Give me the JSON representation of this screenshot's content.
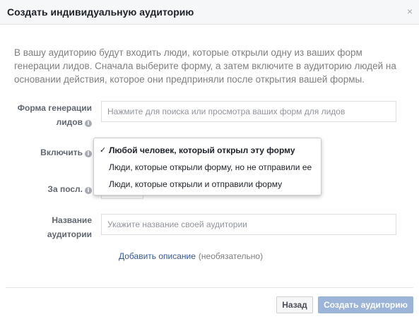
{
  "dialog": {
    "title": "Создать индивидуальную аудиторию",
    "close_icon": "×"
  },
  "intro": "В вашу аудиторию будут входить люди, которые открыли одну из ваших форм генерации лидов. Сначала выберите форму, а затем включите в аудиторию людей на основании действия, которое они предприняли после открытия вашей формы.",
  "form": {
    "lead_form_label_line1": "Форма генерации",
    "lead_form_label_line2": "лидов",
    "lead_form_placeholder": "Нажмите для поиска или просмотра ваших форм для лидов",
    "include_label": "Включить",
    "last_label": "За посл.",
    "audience_name_label_line1": "Название",
    "audience_name_label_line2": "аудитории",
    "audience_name_placeholder": "Укажите название своей аудитории",
    "info_icon": "i"
  },
  "dropdown": {
    "check_icon": "✓",
    "options": [
      "Любой человек, который открыл эту форму",
      "Люди, которые открыли форму, но не отправили ее",
      "Люди, которые открыли и отправили форму"
    ],
    "selected_index": 0
  },
  "description": {
    "link": "Добавить описание",
    "optional": "(необязательно)"
  },
  "footer": {
    "back_label": "Назад",
    "create_label": "Создать аудиторию"
  }
}
